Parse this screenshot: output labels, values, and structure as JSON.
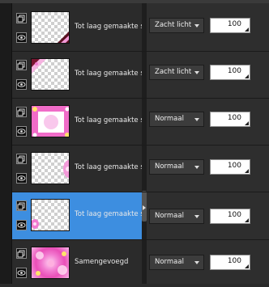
{
  "layers": [
    {
      "name": "Tot laag gemaakte se",
      "blend": "Zacht licht",
      "opacity": "100",
      "selected": false,
      "thumb": "transparent-corner"
    },
    {
      "name": "Tot laag gemaakte se",
      "blend": "Zacht licht",
      "opacity": "100",
      "selected": false,
      "thumb": "transparent-pink-corner"
    },
    {
      "name": "Tot laag gemaakte se",
      "blend": "Normaal",
      "opacity": "100",
      "selected": false,
      "thumb": "pink-frame"
    },
    {
      "name": "Tot laag gemaakte se",
      "blend": "Normaal",
      "opacity": "100",
      "selected": false,
      "thumb": "transparent-pink-edge"
    },
    {
      "name": "Tot laag gemaakte se",
      "blend": "Normaal",
      "opacity": "100",
      "selected": true,
      "thumb": "transparent-pink-dot"
    },
    {
      "name": "Samengevoegd",
      "blend": "Normaal",
      "opacity": "100",
      "selected": false,
      "thumb": "pink-full"
    }
  ],
  "icons": {
    "group": "layer-group-icon",
    "visibility": "eye-icon"
  },
  "colors": {
    "selection": "#3d8ee0",
    "panel": "#2b2b2b",
    "accent_pink": "#e94fb8"
  }
}
